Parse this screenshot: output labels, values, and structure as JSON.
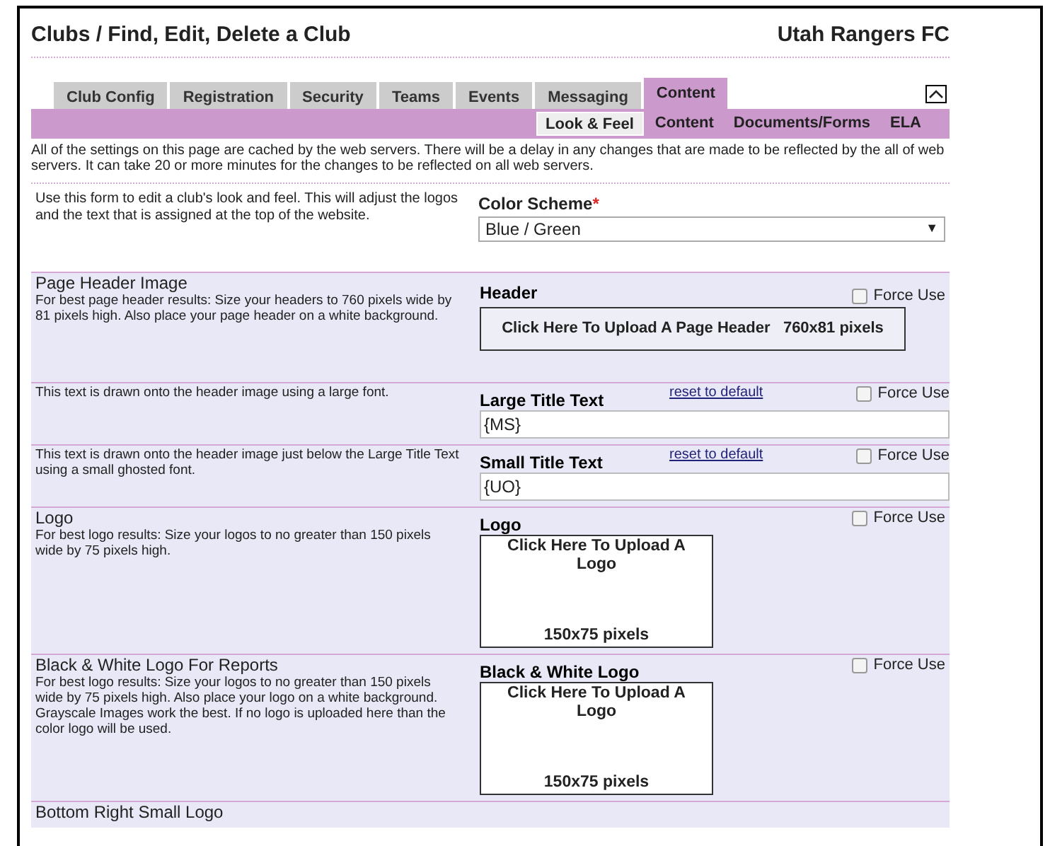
{
  "header": {
    "title": "Clubs / Find, Edit, Delete a Club",
    "club": "Utah Rangers FC"
  },
  "tabs": [
    {
      "label": "Club Config",
      "selected": false
    },
    {
      "label": "Registration",
      "selected": false
    },
    {
      "label": "Security",
      "selected": false
    },
    {
      "label": "Teams",
      "selected": false
    },
    {
      "label": "Events",
      "selected": false
    },
    {
      "label": "Messaging",
      "selected": false
    },
    {
      "label": "Content",
      "selected": true
    }
  ],
  "subtabs": [
    {
      "label": "Look & Feel",
      "selected": true
    },
    {
      "label": "Content",
      "selected": false
    },
    {
      "label": "Documents/Forms",
      "selected": false
    },
    {
      "label": "ELA",
      "selected": false
    }
  ],
  "notice": "All of the settings on this page are cached by the web servers. There will be a delay in any changes that are made to be reflected by the all of web servers. It can take 20 or more minutes for the changes to be reflected on all web servers.",
  "intro": {
    "text": "Use this form to edit a club's look and feel. This will adjust the logos and the text that is assigned at the top of the website.",
    "field_label": "Color Scheme",
    "required_mark": "*",
    "value": "Blue / Green",
    "caret": "▼"
  },
  "rows": [
    {
      "kind": "wide-upload",
      "title": "Page Header Image",
      "description": "For best page header results: Size your headers to 760 pixels wide by 81 pixels high. Also place your page header on a white background.",
      "field_label": "Header",
      "upload_text": "Click Here To Upload A Page Header   760x81 pixels",
      "force_label": "Force Use",
      "checked": false
    },
    {
      "kind": "text",
      "description": "This text is drawn onto the header image using a large font.",
      "field_label": "Large Title Text",
      "reset": "reset to default",
      "value": "{MS}",
      "force_label": "Force Use",
      "checked": false
    },
    {
      "kind": "text",
      "description": "This text is drawn onto the header image just below the Large Title Text using a small ghosted font.",
      "field_label": "Small Title Text",
      "reset": "reset to default",
      "value": "{UO}",
      "force_label": "Force Use",
      "checked": false
    },
    {
      "kind": "logo-upload",
      "title": "Logo",
      "description": "For best logo results: Size your logos to no greater than 150 pixels wide by 75 pixels high.",
      "field_label": "Logo",
      "upload_text": "Click Here To Upload A Logo",
      "size_text": "150x75 pixels",
      "force_label": "Force Use",
      "checked": false
    },
    {
      "kind": "logo-upload",
      "title": "Black & White Logo For Reports",
      "description": "For best logo results: Size your logos to no greater than 150 pixels wide by 75 pixels high. Also place your logo on a white background. Grayscale Images work the best. If no logo is uploaded here than the color logo will be used.",
      "field_label": "Black & White Logo",
      "upload_text": "Click Here To Upload A Logo",
      "size_text": "150x75 pixels",
      "force_label": "Force Use",
      "checked": false
    },
    {
      "kind": "title-only",
      "title": "Bottom Right Small Logo"
    }
  ]
}
